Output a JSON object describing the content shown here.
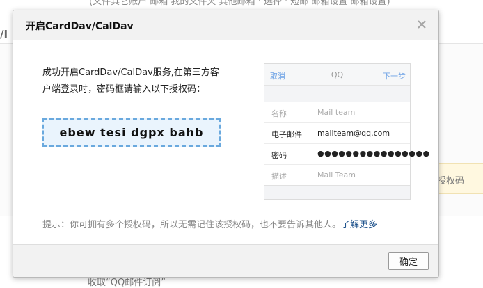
{
  "background": {
    "top_text": "(文件其它账户 邮箱 我的文件夹 其他邮箱 · 选择 · 短邮 邮箱设置 邮箱设置)",
    "left_fragment": "/I",
    "badge_text": "授权码",
    "bottom_link": "收取“QQ邮件订阅”"
  },
  "dialog": {
    "title": "开启CardDav/CalDav",
    "intro_line1": "成功开启CardDav/CalDav服务,在第三方客",
    "intro_line2": "户端登录时，密码框请输入以下授权码：",
    "auth_code": "ebew tesi dgpx bahb",
    "hint_text": "提示：你可拥有多个授权码，所以无需记住该授权码，也不要告诉其他人。",
    "learn_more": "了解更多",
    "ok_label": "确定",
    "close_icon": "close-icon"
  },
  "phone": {
    "nav": {
      "cancel": "取消",
      "title": "QQ",
      "next": "下一步"
    },
    "rows": [
      {
        "label": "名称",
        "value": "Mail team"
      },
      {
        "label": "电子邮件",
        "value": "mailteam@qq.com"
      },
      {
        "label": "密码",
        "value": "●●●●●●●●●●●●●●●●"
      },
      {
        "label": "描述",
        "value": "Mail Team"
      }
    ]
  },
  "colors": {
    "accent_link": "#1a4f8a",
    "code_border": "#6aa9de",
    "code_bg": "#eaf4fd",
    "phone_nav_link": "#6fa3e6"
  }
}
